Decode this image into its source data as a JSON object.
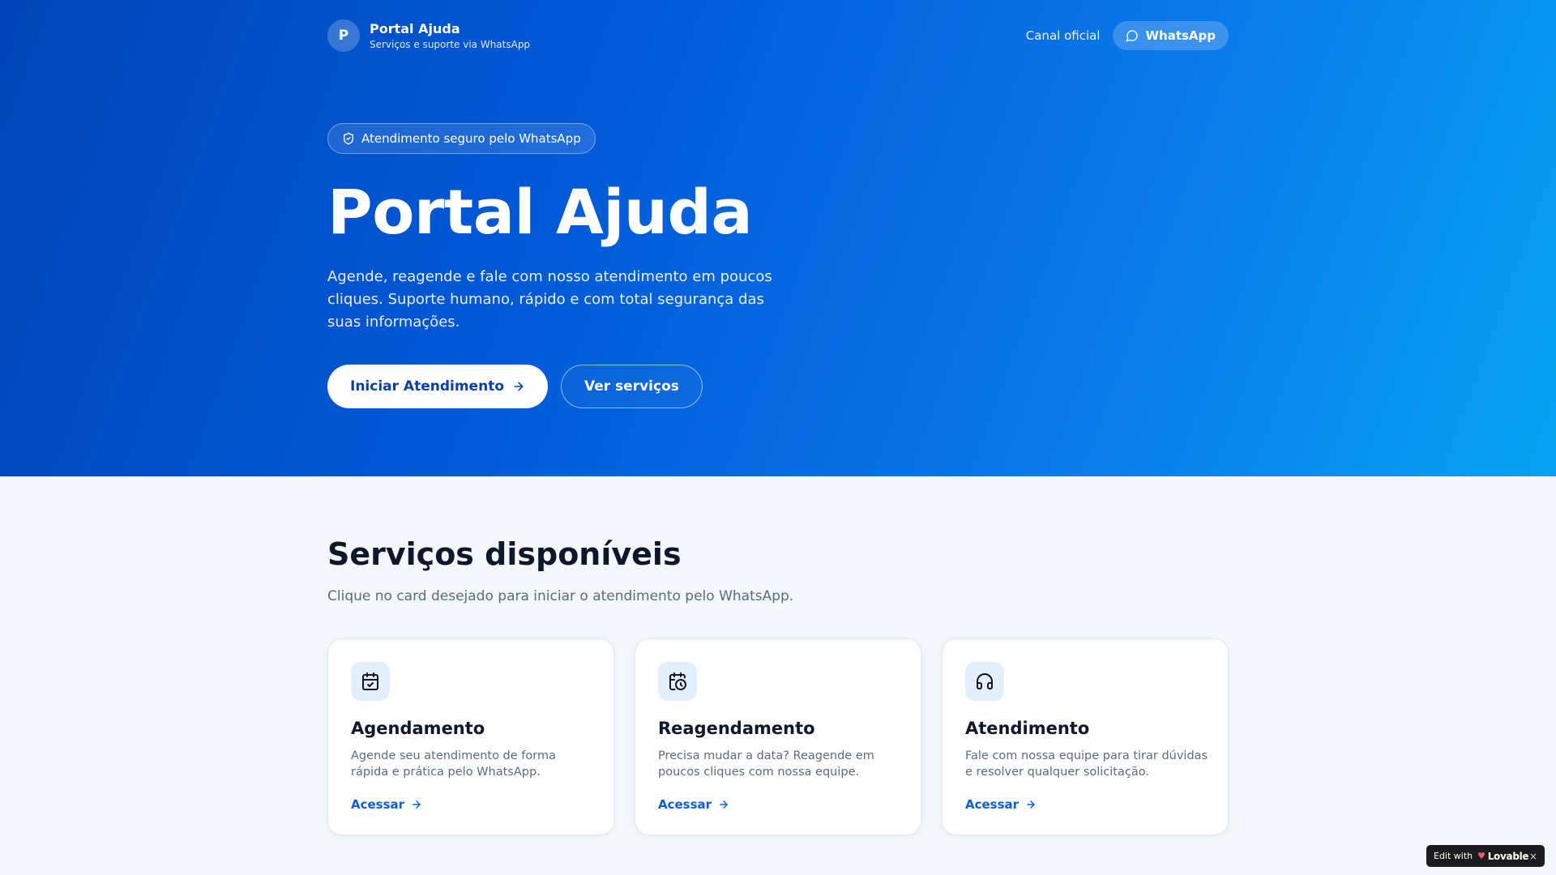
{
  "brand": {
    "initial": "P",
    "name": "Portal Ajuda",
    "tagline": "Serviços e suporte via WhatsApp"
  },
  "nav": {
    "channel_label": "Canal oficial",
    "whatsapp_label": "WhatsApp"
  },
  "hero": {
    "badge": "Atendimento seguro pelo WhatsApp",
    "title": "Portal Ajuda",
    "description": "Agende, reagende e fale com nosso atendimento em poucos cliques. Suporte humano, rápido e com total segurança das suas informações.",
    "primary_button": "Iniciar Atendimento",
    "secondary_button": "Ver serviços"
  },
  "services": {
    "title": "Serviços disponíveis",
    "subtitle": "Clique no card desejado para iniciar o atendimento pelo WhatsApp.",
    "cards": [
      {
        "icon": "calendar-check-icon",
        "title": "Agendamento",
        "description": "Agende seu atendimento de forma rápida e prática pelo WhatsApp.",
        "link": "Acessar"
      },
      {
        "icon": "calendar-clock-icon",
        "title": "Reagendamento",
        "description": "Precisa mudar a data? Reagende em poucos cliques com nossa equipe.",
        "link": "Acessar"
      },
      {
        "icon": "headphones-icon",
        "title": "Atendimento",
        "description": "Fale com nossa equipe para tirar dúvidas e resolver qualquer solicitação.",
        "link": "Acessar"
      }
    ]
  },
  "lovable_badge": {
    "edit_label": "Edit with",
    "brand": "Lovable",
    "close": "×"
  },
  "colors": {
    "hero_gradient_start": "#0046b8",
    "hero_gradient_end": "#06a3f2",
    "primary_text": "#0b3fa3",
    "link": "#0a5ed7",
    "page_background": "#f4f7fb"
  }
}
